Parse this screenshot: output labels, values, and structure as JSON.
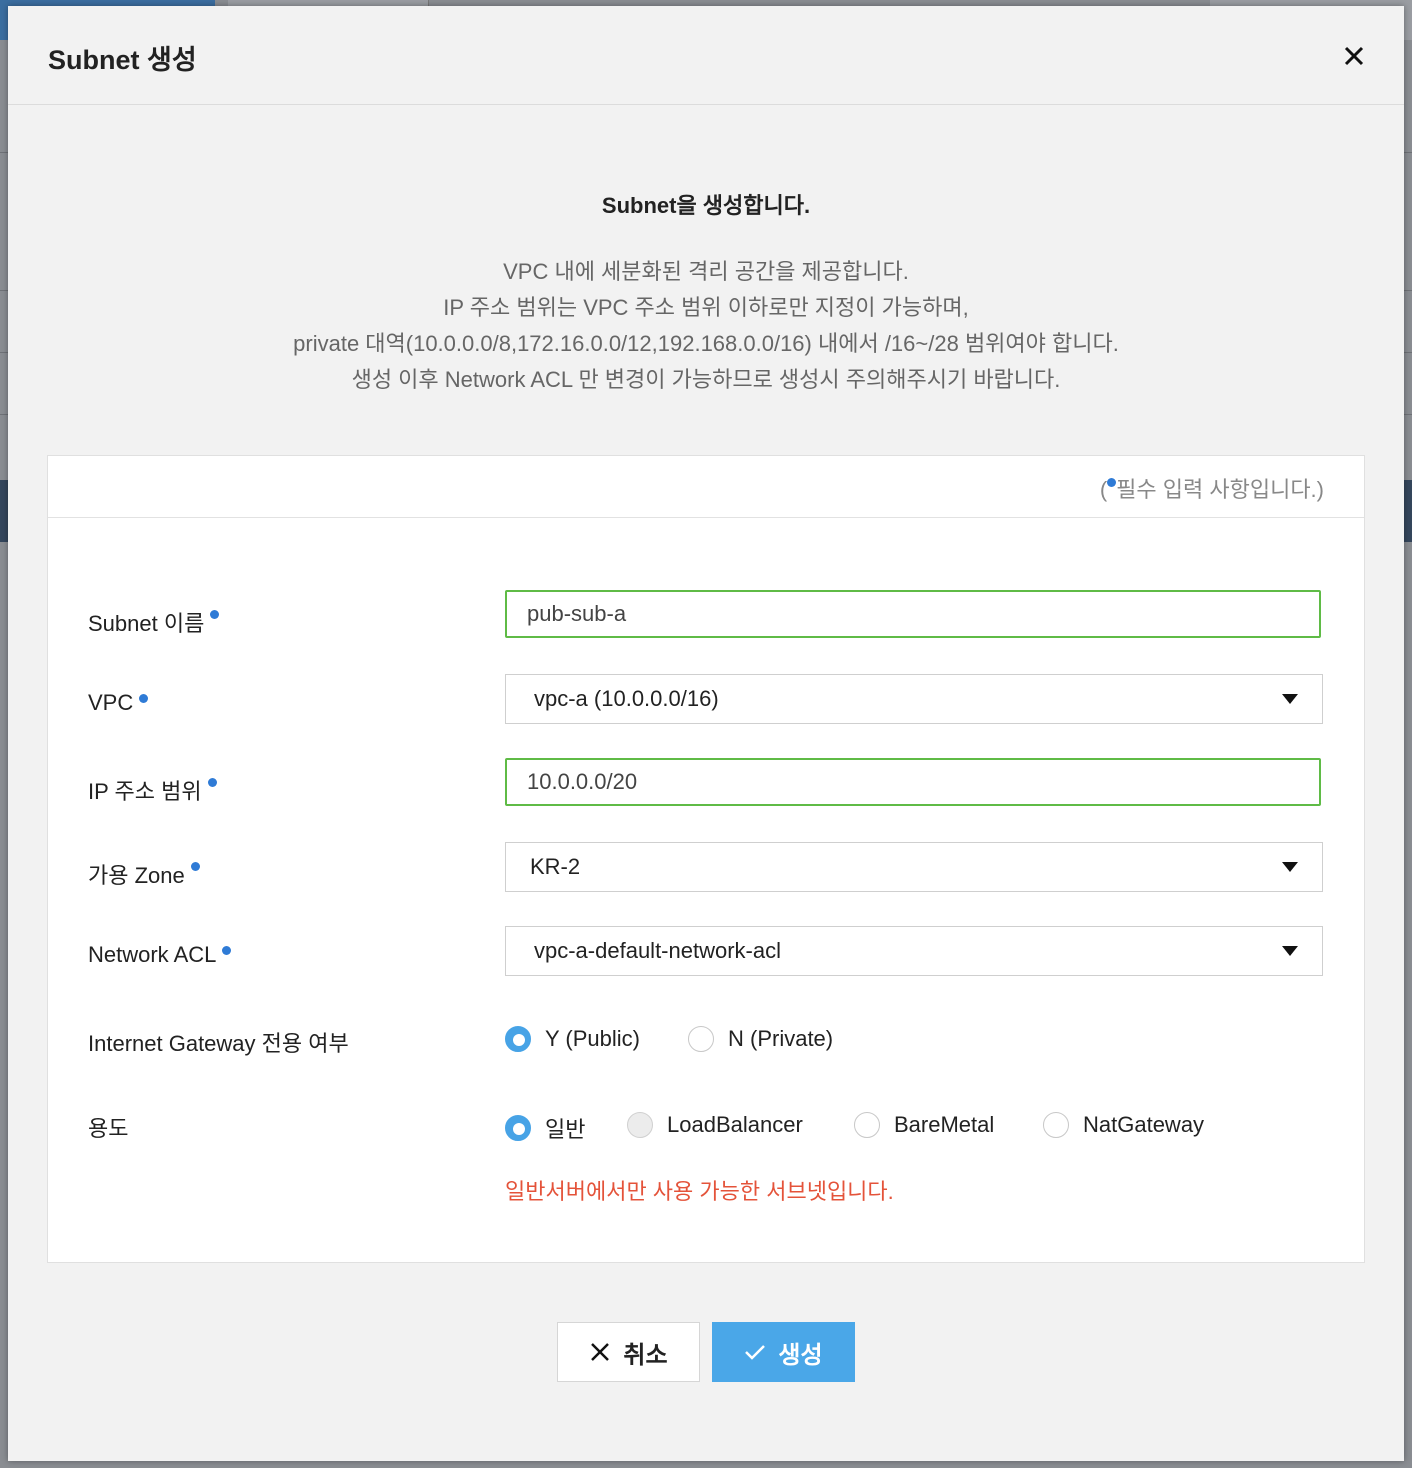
{
  "modal": {
    "title": "Subnet 생성",
    "intro_title": "Subnet을 생성합니다.",
    "intro_lines": [
      "VPC 내에 세분화된 격리 공간을 제공합니다.",
      "IP 주소 범위는 VPC 주소 범위 이하로만 지정이 가능하며,",
      "private 대역(10.0.0.0/8,172.16.0.0/12,192.168.0.0/16) 내에서 /16~/28 범위여야 합니다.",
      "생성 이후 Network ACL 만 변경이 가능하므로 생성시 주의해주시기 바랍니다."
    ]
  },
  "form": {
    "required_note_prefix": "(",
    "required_note_suffix": "필수 입력 사항입니다.)",
    "subnet_name": {
      "label": "Subnet 이름",
      "value": "pub-sub-a"
    },
    "vpc": {
      "label": "VPC",
      "value": "vpc-a (10.0.0.0/16)"
    },
    "ip_range": {
      "label": "IP 주소 범위",
      "value": "10.0.0.0/20"
    },
    "zone": {
      "label": "가용 Zone",
      "value": "KR-2"
    },
    "network_acl": {
      "label": "Network ACL",
      "value": "vpc-a-default-network-acl"
    },
    "igw": {
      "label": "Internet Gateway 전용 여부",
      "options": [
        "Y (Public)",
        "N (Private)"
      ],
      "selected": "Y (Public)"
    },
    "usage": {
      "label": "용도",
      "options": [
        "일반",
        "LoadBalancer",
        "BareMetal",
        "NatGateway"
      ],
      "selected": "일반",
      "disabled": [
        "LoadBalancer"
      ],
      "hint": "일반서버에서만 사용 가능한 서브넷입니다."
    }
  },
  "buttons": {
    "cancel": "취소",
    "create": "생성"
  },
  "colors": {
    "accent": "#4aa7e8",
    "required_dot": "#2f7bd6",
    "valid_border": "#5fbb46",
    "hint_red": "#e4533a"
  }
}
